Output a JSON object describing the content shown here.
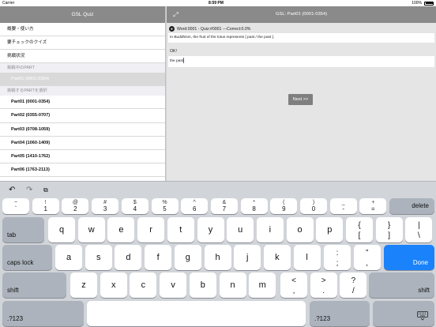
{
  "status_bar": {
    "carrier": "Carrier",
    "time": "8:59 PM",
    "battery": "100%"
  },
  "master": {
    "title": "GSL Quiz",
    "menu": [
      {
        "label": "概要・使い方"
      },
      {
        "label": "要チェックのクイズ"
      },
      {
        "label": "挑戦状況"
      }
    ],
    "section_current": "挑戦中のPART",
    "current_part": "Part01 (0001-0354)",
    "section_select": "挑戦するPARTを選択",
    "parts": [
      {
        "label": "Part01 (0001-0354)"
      },
      {
        "label": "Part02 (0355-0707)"
      },
      {
        "label": "Part03 (0708-1059)"
      },
      {
        "label": "Part04 (1060-1409)"
      },
      {
        "label": "Part05 (1410-1762)"
      },
      {
        "label": "Part06 (1763-2113)"
      }
    ]
  },
  "detail": {
    "title": "GSL: Part01 (0001-0354)",
    "info": "Word:0001 - Quiz:#0001   ---Correct:0.0%",
    "question": "In Buddhism, the fruit of the lotus represents [ past / the past ].",
    "result": "OK!",
    "answer": "the past",
    "next_label": "Next >>"
  },
  "keyboard": {
    "assist": {
      "undo": "↶",
      "redo": "↷",
      "paste": "⧉"
    },
    "number_row": [
      {
        "top": "~",
        "bottom": "`"
      },
      {
        "top": "!",
        "bottom": "1"
      },
      {
        "top": "@",
        "bottom": "2"
      },
      {
        "top": "#",
        "bottom": "3"
      },
      {
        "top": "$",
        "bottom": "4"
      },
      {
        "top": "%",
        "bottom": "5"
      },
      {
        "top": "^",
        "bottom": "6"
      },
      {
        "top": "&",
        "bottom": "7"
      },
      {
        "top": "*",
        "bottom": "8"
      },
      {
        "top": "(",
        "bottom": "9"
      },
      {
        "top": ")",
        "bottom": "0"
      },
      {
        "top": "_",
        "bottom": "-"
      },
      {
        "top": "+",
        "bottom": "="
      }
    ],
    "delete": "delete",
    "tab": "tab",
    "row1": [
      "q",
      "w",
      "e",
      "r",
      "t",
      "y",
      "u",
      "i",
      "o",
      "p"
    ],
    "row1_extra": [
      {
        "top": "{",
        "bottom": "["
      },
      {
        "top": "}",
        "bottom": "]"
      },
      {
        "top": "|",
        "bottom": "\\"
      }
    ],
    "caps_lock": "caps lock",
    "row2": [
      "a",
      "s",
      "d",
      "f",
      "g",
      "h",
      "j",
      "k",
      "l"
    ],
    "row2_extra": [
      {
        "top": ":",
        "bottom": ";"
      },
      {
        "top": "”",
        "bottom": ","
      }
    ],
    "done": "Done",
    "shift": "shift",
    "row3": [
      "z",
      "x",
      "c",
      "v",
      "b",
      "n",
      "m"
    ],
    "row3_extra": [
      {
        "top": "<",
        "bottom": ","
      },
      {
        "top": ">",
        "bottom": "."
      },
      {
        "top": "?",
        "bottom": "/"
      }
    ],
    "numbers_toggle": ".?123",
    "dismiss_icon": "keyboard-dismiss-icon",
    "colors": {
      "done": "#1a82fb",
      "header": "#8a8a8a"
    }
  }
}
